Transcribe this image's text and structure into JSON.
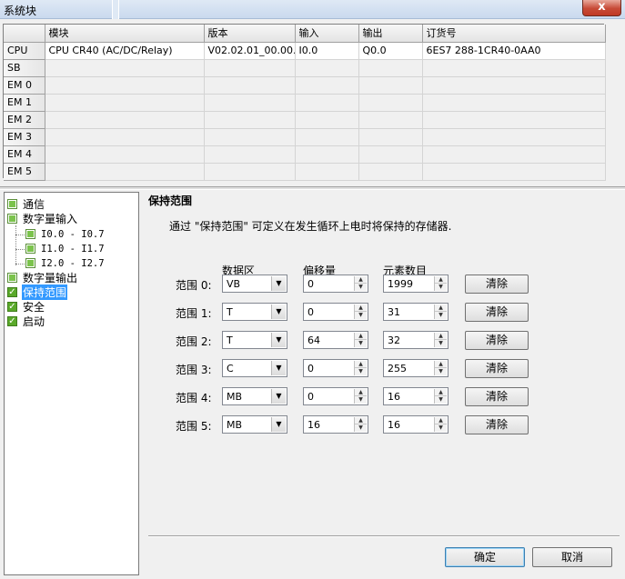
{
  "window": {
    "title": "系统块",
    "close_label": "x"
  },
  "grid": {
    "headers": [
      "",
      "模块",
      "版本",
      "输入",
      "输出",
      "订货号"
    ],
    "rows": [
      {
        "slot": "CPU",
        "module": "CPU CR40 (AC/DC/Relay)",
        "version": "V02.02.01_00.00...",
        "input": "I0.0",
        "output": "Q0.0",
        "order": "6ES7 288-1CR40-0AA0"
      },
      {
        "slot": "SB",
        "module": "",
        "version": "",
        "input": "",
        "output": "",
        "order": ""
      },
      {
        "slot": "EM 0",
        "module": "",
        "version": "",
        "input": "",
        "output": "",
        "order": ""
      },
      {
        "slot": "EM 1",
        "module": "",
        "version": "",
        "input": "",
        "output": "",
        "order": ""
      },
      {
        "slot": "EM 2",
        "module": "",
        "version": "",
        "input": "",
        "output": "",
        "order": ""
      },
      {
        "slot": "EM 3",
        "module": "",
        "version": "",
        "input": "",
        "output": "",
        "order": ""
      },
      {
        "slot": "EM 4",
        "module": "",
        "version": "",
        "input": "",
        "output": "",
        "order": ""
      },
      {
        "slot": "EM 5",
        "module": "",
        "version": "",
        "input": "",
        "output": "",
        "order": ""
      }
    ]
  },
  "tree": {
    "comm": "通信",
    "digital_input": "数字量输入",
    "di_0": "I0.0 - I0.7",
    "di_1": "I1.0 - I1.7",
    "di_2": "I2.0 - I2.7",
    "digital_output": "数字量输出",
    "retentive": "保持范围",
    "security": "安全",
    "startup": "启动"
  },
  "panel": {
    "title": "保持范围",
    "description": "通过 \"保持范围\" 可定义在发生循环上电时将保持的存储器.",
    "col_area": "数据区",
    "col_offset": "偏移量",
    "col_count": "元素数目",
    "clear_label": "清除",
    "ranges": [
      {
        "label": "范围 0:",
        "area": "VB",
        "offset": "0",
        "count": "1999"
      },
      {
        "label": "范围 1:",
        "area": "T",
        "offset": "0",
        "count": "31"
      },
      {
        "label": "范围 2:",
        "area": "T",
        "offset": "64",
        "count": "32"
      },
      {
        "label": "范围 3:",
        "area": "C",
        "offset": "0",
        "count": "255"
      },
      {
        "label": "范围 4:",
        "area": "MB",
        "offset": "0",
        "count": "16"
      },
      {
        "label": "范围 5:",
        "area": "MB",
        "offset": "16",
        "count": "16"
      }
    ]
  },
  "footer": {
    "ok_label": "确定",
    "cancel_label": "取消"
  },
  "colors": {
    "selection": "#3399ff",
    "checkbox_green": "#5aa92a"
  }
}
